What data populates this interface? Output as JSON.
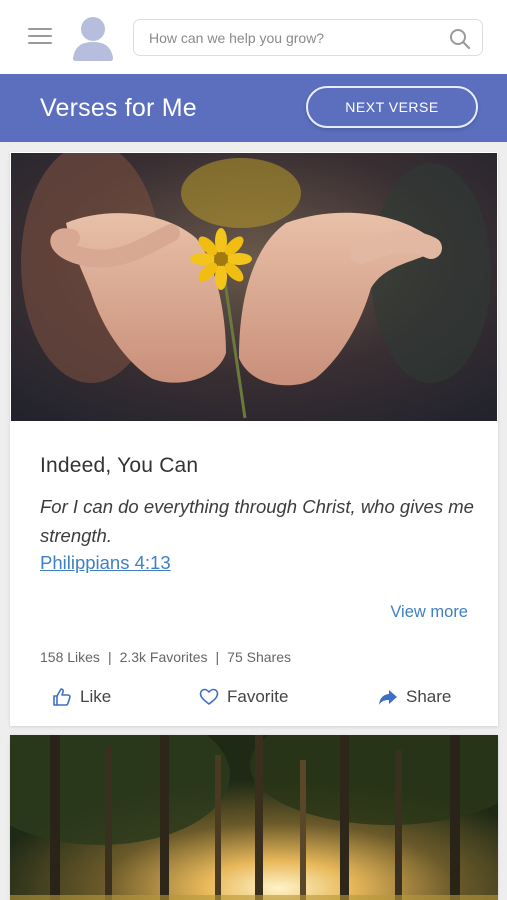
{
  "search": {
    "placeholder": "How can we help you grow?"
  },
  "header": {
    "title": "Verses for Me",
    "next_button": "NEXT VERSE"
  },
  "card": {
    "title": "Indeed, You Can",
    "verse_text": "For I can do everything through Christ, who gives me strength.",
    "reference": "Philippians 4:13",
    "view_more": "View more",
    "stats": {
      "likes": "158 Likes",
      "favorites": "2.3k Favorites",
      "shares": "75 Shares",
      "separator": "|"
    },
    "actions": {
      "like": "Like",
      "favorite": "Favorite",
      "share": "Share"
    }
  },
  "colors": {
    "accent": "#5b6fbe",
    "link": "#3f80c4"
  },
  "icons": [
    "menu-icon",
    "avatar-icon",
    "search-icon",
    "thumbs-up-icon",
    "heart-icon",
    "share-arrow-icon"
  ]
}
